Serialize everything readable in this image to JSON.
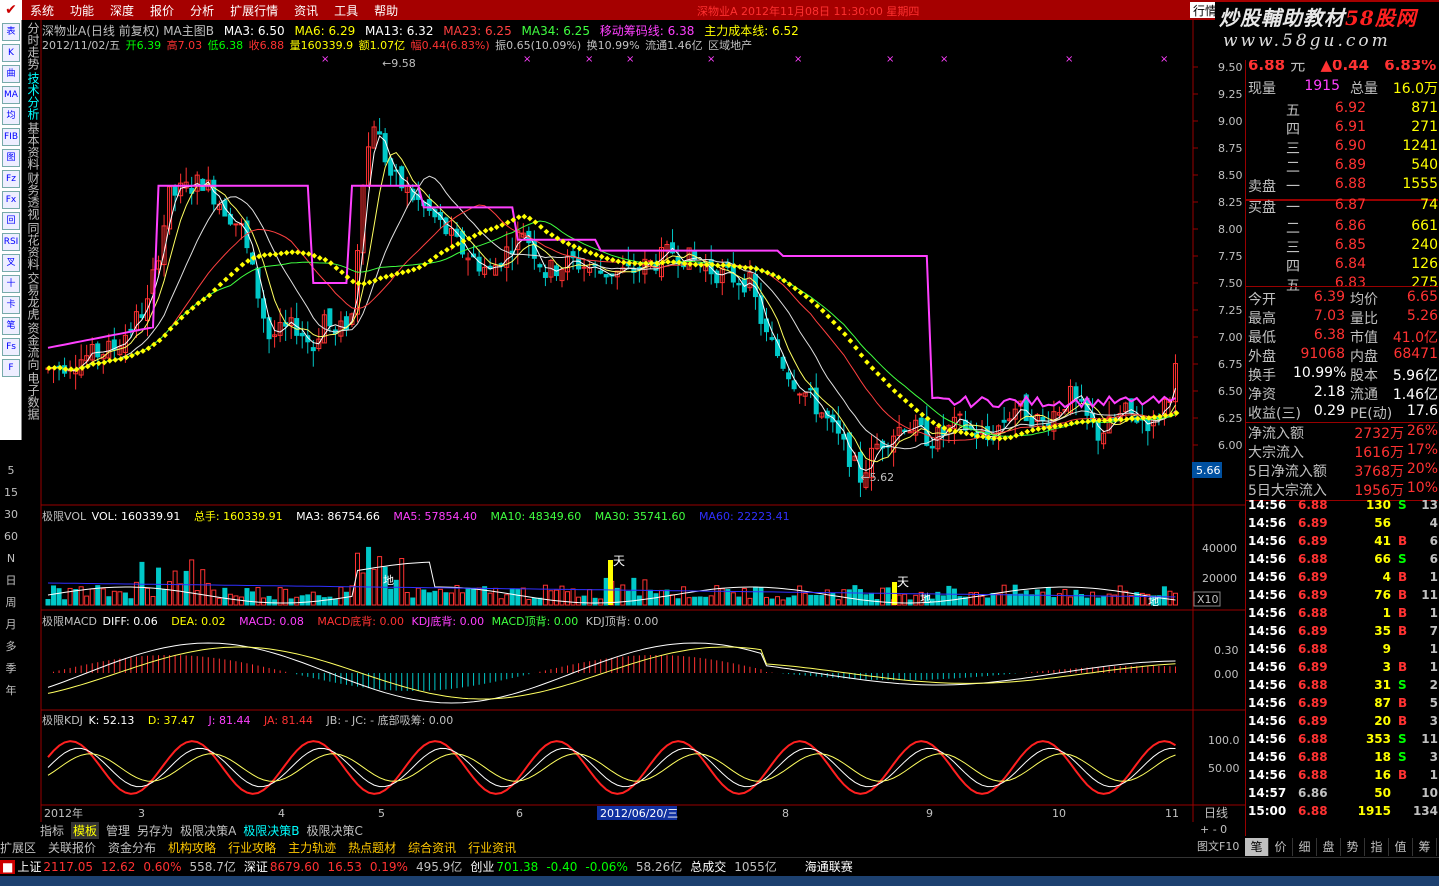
{
  "menu": {
    "items": [
      "系统",
      "功能",
      "深度",
      "报价",
      "分析",
      "扩展行情",
      "资讯",
      "工具",
      "帮助"
    ],
    "window_title": "深物业A 2012年11月08日 11:30:00 星期四",
    "right_tab": "行情"
  },
  "watermark": {
    "line1_a": "炒股輔助教材",
    "line1_b": "58股网",
    "line2": "www.58gu.com"
  },
  "left_tabs": [
    "分时走势",
    "技术分析",
    "基本资料",
    "财务透视",
    "同花资料",
    "交易龙虎",
    "资金流向",
    "电子数据"
  ],
  "left_tools": [
    "表",
    "K",
    "曲",
    "MA",
    "均",
    "FIB",
    "图",
    "Fz",
    "Fx",
    "回",
    "RSI",
    "叉",
    "十",
    "卡",
    "笔",
    "Fs",
    "F"
  ],
  "periods": [
    "5",
    "15",
    "30",
    "60",
    "N",
    "日",
    "周",
    "月",
    "多",
    "季",
    "年"
  ],
  "chart_header": {
    "title": "深物业A(日线 前复权) MA主图B",
    "ma3": "MA3: 6.50",
    "ma6": "MA6: 6.29",
    "ma13": "MA13: 6.32",
    "ma23": "MA23: 6.25",
    "ma34": "MA34: 6.25",
    "move": "移动筹码线: 6.38",
    "cost": "主力成本线: 6.52"
  },
  "chart_info": {
    "date": "2012/11/02/五",
    "open": "开6.39",
    "high": "高7.03",
    "low": "低6.38",
    "close": "收6.88",
    "vol": "量160339.9",
    "amount": "额1.07亿",
    "change": "幅0.44(6.83%)",
    "amplitude": "振0.65(10.09%)",
    "turnover": "换10.99%",
    "float": "流通1.46亿",
    "sector": "区域地产"
  },
  "price_axis": [
    "9.50",
    "9.25",
    "9.00",
    "8.75",
    "8.50",
    "8.25",
    "8.00",
    "7.75",
    "7.50",
    "7.25",
    "7.00",
    "6.75",
    "6.50",
    "6.25",
    "6.00"
  ],
  "price_marker": "5.66",
  "annotations": {
    "high": "9.58",
    "low": "5.62"
  },
  "vol_info": {
    "title": "极限VOL",
    "vol": "VOL: 160339.91",
    "total": "总手: 160339.91",
    "ma3": "MA3: 86754.66",
    "ma5": "MA5: 57854.40",
    "ma10": "MA10: 48349.60",
    "ma30": "MA30: 35741.60",
    "ma60": "MA60: 22223.41"
  },
  "vol_axis": [
    "40000",
    "20000"
  ],
  "vol_scale": "X10",
  "vol_labels": {
    "tian": "天",
    "di": "地"
  },
  "macd_info": {
    "title": "极限MACD",
    "diff": "DIFF: 0.06",
    "dea": "DEA: 0.02",
    "macd": "MACD: 0.08",
    "macd_bottom": "MACD底背: 0.00",
    "kdj_bottom": "KDJ底背: 0.00",
    "macd_top": "MACD顶背: 0.00",
    "kdj_top": "KDJ顶背: 0.00"
  },
  "macd_axis": [
    "0.30",
    "0.00"
  ],
  "kdj_info": {
    "title": "极限KDJ",
    "k": "K: 52.13",
    "d": "D: 37.47",
    "j": "J: 81.44",
    "ja": "JA: 81.44",
    "jb": "JB: - JC: - 底部吸筹: 0.00"
  },
  "kdj_axis": [
    "100.0",
    "50.00"
  ],
  "time_axis": {
    "labels": [
      "2012年",
      "3",
      "4",
      "5",
      "6",
      "2012/06/20/三",
      "8",
      "9",
      "10",
      "11"
    ],
    "right_label": "日线"
  },
  "quote": {
    "price": "6.88",
    "unit": "元",
    "change": "0.44",
    "pct": "6.83%",
    "now_label": "现量",
    "now": "1915",
    "total_label": "总量",
    "total": "16.0万",
    "sell": [
      {
        "lvl": "五",
        "price": "6.92",
        "vol": "871"
      },
      {
        "lvl": "四",
        "price": "6.91",
        "vol": "271"
      },
      {
        "lvl": "三",
        "price": "6.90",
        "vol": "1241"
      },
      {
        "lvl": "二",
        "price": "6.89",
        "vol": "540"
      },
      {
        "lvl": "一",
        "price": "6.88",
        "vol": "1555"
      }
    ],
    "sell_label": "卖盘",
    "buy_label": "买盘",
    "buy": [
      {
        "lvl": "一",
        "price": "6.87",
        "vol": "74"
      },
      {
        "lvl": "二",
        "price": "6.86",
        "vol": "661"
      },
      {
        "lvl": "三",
        "price": "6.85",
        "vol": "240"
      },
      {
        "lvl": "四",
        "price": "6.84",
        "vol": "126"
      },
      {
        "lvl": "五",
        "price": "6.83",
        "vol": "275"
      }
    ],
    "stats": [
      {
        "l1": "今开",
        "v1": "6.39",
        "l2": "均价",
        "v2": "6.65"
      },
      {
        "l1": "最高",
        "v1": "7.03",
        "l2": "量比",
        "v2": "5.26"
      },
      {
        "l1": "最低",
        "v1": "6.38",
        "l2": "市值",
        "v2": "41.0亿"
      },
      {
        "l1": "外盘",
        "v1": "91068",
        "l2": "内盘",
        "v2": "68471"
      },
      {
        "l1": "换手",
        "v1": "10.99%",
        "l2": "股本",
        "v2": "5.96亿"
      },
      {
        "l1": "净资",
        "v1": "2.18",
        "l2": "流通",
        "v2": "1.46亿"
      },
      {
        "l1": "收益(三)",
        "v1": "0.29",
        "l2": "PE(动)",
        "v2": "17.6"
      }
    ],
    "flows": [
      {
        "l": "净流入额",
        "v": "2732万",
        "p": "26%"
      },
      {
        "l": "大宗流入",
        "v": "1616万",
        "p": "17%"
      },
      {
        "l": "5日净流入额",
        "v": "3768万",
        "p": "20%"
      },
      {
        "l": "5日大宗流入",
        "v": "1956万",
        "p": "10%"
      }
    ]
  },
  "ticks": [
    {
      "t": "14:56",
      "p": "6.88",
      "v": "130",
      "s": "S",
      "n": "13"
    },
    {
      "t": "14:56",
      "p": "6.89",
      "v": "56",
      "s": "",
      "n": "4"
    },
    {
      "t": "14:56",
      "p": "6.89",
      "v": "41",
      "s": "B",
      "n": "6"
    },
    {
      "t": "14:56",
      "p": "6.88",
      "v": "66",
      "s": "S",
      "n": "6"
    },
    {
      "t": "14:56",
      "p": "6.89",
      "v": "4",
      "s": "B",
      "n": "1"
    },
    {
      "t": "14:56",
      "p": "6.89",
      "v": "76",
      "s": "B",
      "n": "11"
    },
    {
      "t": "14:56",
      "p": "6.88",
      "v": "1",
      "s": "B",
      "n": "1"
    },
    {
      "t": "14:56",
      "p": "6.89",
      "v": "35",
      "s": "B",
      "n": "7"
    },
    {
      "t": "14:56",
      "p": "6.88",
      "v": "9",
      "s": "",
      "n": "1"
    },
    {
      "t": "14:56",
      "p": "6.89",
      "v": "3",
      "s": "B",
      "n": "1"
    },
    {
      "t": "14:56",
      "p": "6.88",
      "v": "31",
      "s": "S",
      "n": "2"
    },
    {
      "t": "14:56",
      "p": "6.89",
      "v": "87",
      "s": "B",
      "n": "5"
    },
    {
      "t": "14:56",
      "p": "6.89",
      "v": "20",
      "s": "B",
      "n": "3"
    },
    {
      "t": "14:56",
      "p": "6.88",
      "v": "353",
      "s": "S",
      "n": "11"
    },
    {
      "t": "14:56",
      "p": "6.88",
      "v": "18",
      "s": "S",
      "n": "3"
    },
    {
      "t": "14:56",
      "p": "6.88",
      "v": "16",
      "s": "B",
      "n": "1"
    },
    {
      "t": "14:57",
      "p": "6.86",
      "v": "50",
      "s": "",
      "n": "10"
    },
    {
      "t": "15:00",
      "p": "6.88",
      "v": "1915",
      "s": "",
      "n": "134"
    }
  ],
  "bottom_tabs": [
    "指标",
    "模板",
    "管理",
    "另存为",
    "极限决策A",
    "极限决策B",
    "极限决策C"
  ],
  "link_bar": [
    "扩展区",
    "关联报价",
    "资金分布",
    "机构攻略",
    "行业攻略",
    "主力轨迹",
    "热点题材",
    "综合资讯",
    "行业资讯"
  ],
  "right_bottom_tabs": [
    "笔",
    "价",
    "细",
    "盘",
    "势",
    "指",
    "值",
    "筹"
  ],
  "right_bottom_label": "图文F10",
  "status": {
    "sh_label": "上证",
    "sh": "2117.05",
    "sh_chg": "12.62",
    "sh_pct": "0.60%",
    "sh_amt": "558.7亿",
    "sz_label": "深证",
    "sz": "8679.60",
    "sz_chg": "16.53",
    "sz_pct": "0.19%",
    "sz_amt": "495.9亿",
    "cy_label": "创业",
    "cy": "701.38",
    "cy_chg": "-0.40",
    "cy_pct": "-0.06%",
    "cy_amt": "58.26亿",
    "total_label": "总成交",
    "total": "1055亿",
    "broker": "海通联赛"
  },
  "colors": {
    "up": "#ff3232",
    "down": "#00e0e0",
    "ma_yellow": "#ffff00",
    "magenta": "#ff40ff",
    "bg": "#000000"
  }
}
